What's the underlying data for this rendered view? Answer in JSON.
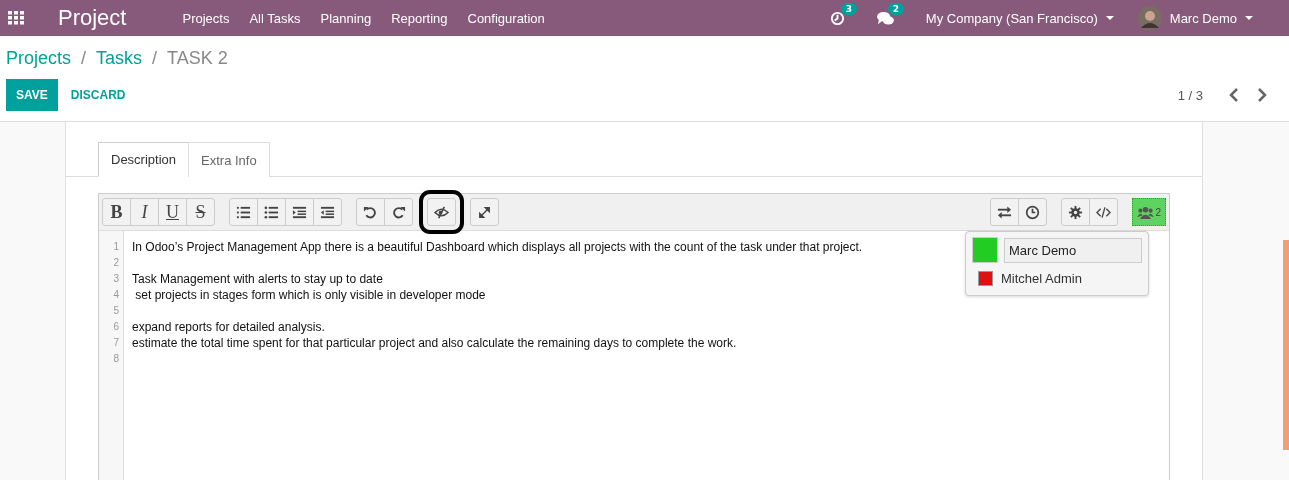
{
  "navbar": {
    "app_name": "Project",
    "menu": [
      "Projects",
      "All Tasks",
      "Planning",
      "Reporting",
      "Configuration"
    ],
    "activity_count": "3",
    "message_count": "2",
    "company": "My Company (San Francisco)",
    "user": "Marc Demo"
  },
  "breadcrumb": [
    {
      "label": "Projects",
      "link": true
    },
    {
      "label": "Tasks",
      "link": true,
      "separator": "/"
    },
    {
      "label": "TASK 2",
      "link": false,
      "separator": "/"
    }
  ],
  "actions": {
    "save": "SAVE",
    "discard": "DISCARD",
    "pager": "1 / 3"
  },
  "tabs": [
    {
      "label": "Description",
      "selected": true
    },
    {
      "label": "Extra Info",
      "selected": false
    }
  ],
  "toolbar_left": [
    {
      "buttons": [
        {
          "kind": "bold",
          "label": "B"
        },
        {
          "kind": "italic",
          "label": "I"
        },
        {
          "kind": "underline",
          "label": "U"
        },
        {
          "kind": "strike",
          "label": "S"
        }
      ]
    },
    {
      "buttons": [
        {
          "kind": "ordered-list"
        },
        {
          "kind": "bullet-list"
        },
        {
          "kind": "indent"
        },
        {
          "kind": "outdent"
        }
      ]
    },
    {
      "buttons": [
        {
          "kind": "undo"
        },
        {
          "kind": "redo"
        }
      ]
    },
    {
      "buttons": [
        {
          "kind": "eye-slash",
          "highlighted": true
        }
      ]
    },
    {
      "buttons": [
        {
          "kind": "expand"
        }
      ]
    }
  ],
  "toolbar_right": [
    {
      "buttons": [
        {
          "kind": "swap"
        },
        {
          "kind": "clock"
        }
      ]
    },
    {
      "buttons": [
        {
          "kind": "gear"
        },
        {
          "kind": "code"
        }
      ]
    }
  ],
  "collaborators": {
    "count": "2",
    "users": [
      {
        "name": "Marc Demo",
        "color": "#22cc22",
        "kind": "field"
      },
      {
        "name": "Mitchel Admin",
        "color": "#dd1111",
        "kind": "plain"
      }
    ]
  },
  "code_lines": [
    {
      "number": "1",
      "text": "In Odoo’s Project Management App there is a beautiful Dashboard which displays all projects with the count of the task under that project."
    },
    {
      "number": "2"
    },
    {
      "number": "3",
      "text": "Task Management with alerts to stay up to date"
    },
    {
      "number": "4",
      "text": " set projects in stages form which is only visible in developer mode"
    },
    {
      "number": "5"
    },
    {
      "number": "6",
      "text": "expand reports for detailed analysis."
    },
    {
      "number": "7",
      "text": "estimate the total time spent for that particular project and also calculate the remaining days to complete the work."
    },
    {
      "number": "8"
    }
  ]
}
